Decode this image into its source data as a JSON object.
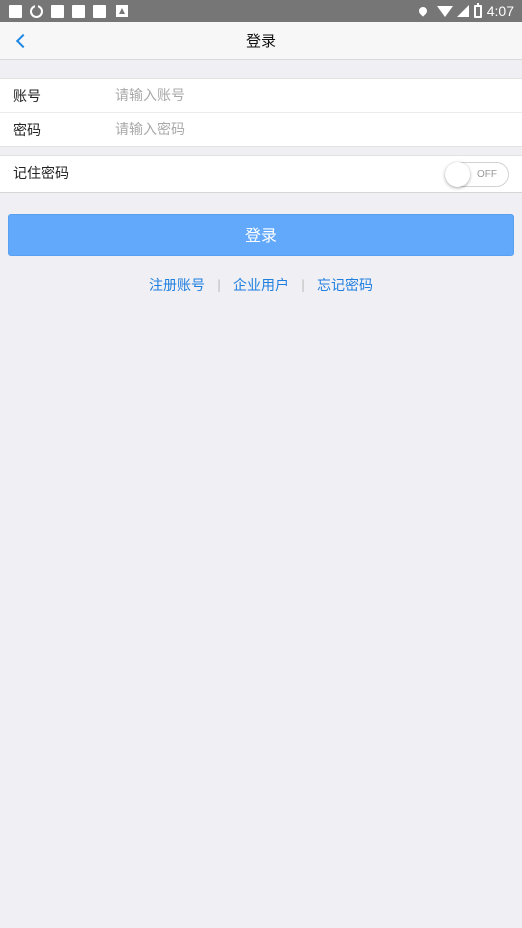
{
  "status_bar": {
    "time": "4:07"
  },
  "nav": {
    "title": "登录",
    "back_icon": "chevron-left-icon"
  },
  "form": {
    "account_label": "账号",
    "account_placeholder": "请输入账号",
    "account_value": "",
    "password_label": "密码",
    "password_placeholder": "请输入密码",
    "password_value": ""
  },
  "remember": {
    "label": "记住密码",
    "toggle_state": "OFF"
  },
  "login_button": {
    "label": "登录"
  },
  "links": {
    "register": "注册账号",
    "enterprise": "企业用户",
    "forgot": "忘记密码",
    "separator": "|"
  },
  "colors": {
    "accent": "#1f7fe0",
    "button_bg": "#62a9fb",
    "page_bg": "#efeff4"
  }
}
